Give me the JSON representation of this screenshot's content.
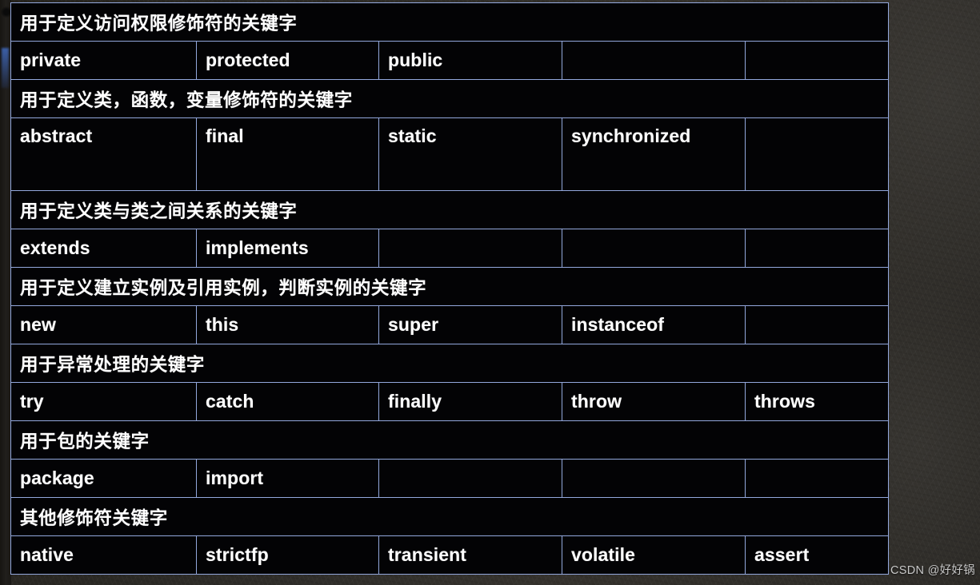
{
  "background": {
    "canvas_color": "#2b2926",
    "table_border_color": "#93a8dd",
    "cell_background": "#030305",
    "text_color": "#ffffff"
  },
  "watermark": {
    "text": "CSDN @好好锅"
  },
  "table": {
    "columns": 5,
    "sections": [
      {
        "heading": "用于定义访问权限修饰符的关键字",
        "row_style": "h-std",
        "keywords": [
          "private",
          "protected",
          "public",
          "",
          ""
        ]
      },
      {
        "heading": "用于定义类，函数，变量修饰符的关键字",
        "row_style": "h-tall",
        "keywords": [
          "abstract",
          "final",
          "static",
          "synchronized",
          ""
        ]
      },
      {
        "heading": "用于定义类与类之间关系的关键字",
        "row_style": "h-std",
        "keywords": [
          "extends",
          "implements",
          "",
          "",
          ""
        ]
      },
      {
        "heading": "用于定义建立实例及引用实例，判断实例的关键字",
        "row_style": "h-std",
        "keywords": [
          "new",
          "this",
          "super",
          "instanceof",
          ""
        ]
      },
      {
        "heading": "用于异常处理的关键字",
        "row_style": "h-std",
        "keywords": [
          "try",
          "catch",
          "finally",
          "throw",
          "throws"
        ]
      },
      {
        "heading": "用于包的关键字",
        "row_style": "h-std",
        "keywords": [
          "package",
          "import",
          "",
          "",
          ""
        ]
      },
      {
        "heading": "其他修饰符关键字",
        "row_style": "h-std",
        "keywords": [
          "native",
          "strictfp",
          "transient",
          "volatile",
          "assert"
        ]
      }
    ]
  }
}
